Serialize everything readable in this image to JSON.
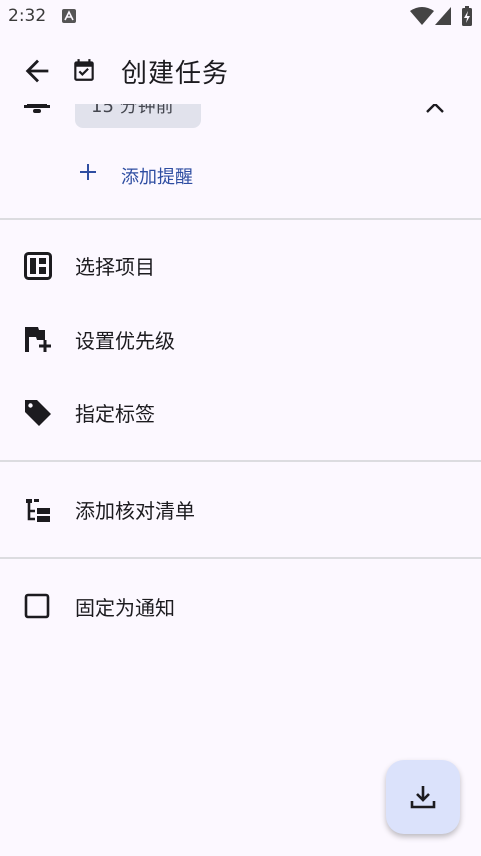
{
  "status_bar": {
    "time": "2:32"
  },
  "app_bar": {
    "title": "创建任务"
  },
  "reminder": {
    "chip_label": "15 分钟前",
    "add_label": "添加提醒"
  },
  "options": [
    {
      "label": "选择项目",
      "icon": "project-board-icon"
    },
    {
      "label": "设置优先级",
      "icon": "flag-plus-icon"
    },
    {
      "label": "指定标签",
      "icon": "tag-icon"
    }
  ],
  "checklist": {
    "label": "添加核对清单",
    "icon": "checklist-tree-icon"
  },
  "pin": {
    "label": "固定为通知",
    "checked": false
  },
  "fab": {
    "icon": "download-icon",
    "color": "#dbe2fb"
  },
  "colors": {
    "background": "#fcf8ff",
    "accent": "#2f4ea2",
    "chip": "#e1e2ec"
  }
}
